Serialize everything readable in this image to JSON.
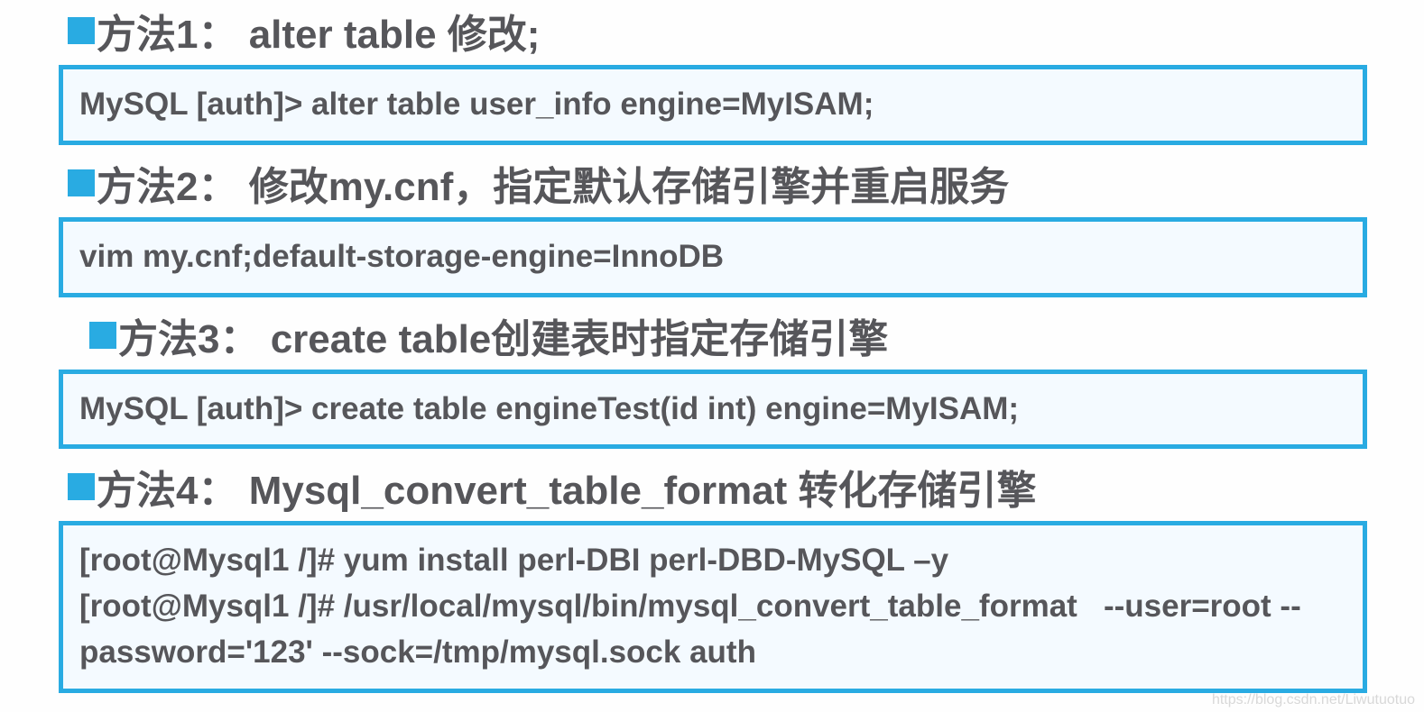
{
  "methods": [
    {
      "heading": "方法1：  alter table 修改;",
      "code": "MySQL [auth]> alter table  user_info engine=MyISAM;",
      "indent": false
    },
    {
      "heading": "方法2：  修改my.cnf，指定默认存储引擎并重启服务",
      "code": "vim  my.cnf;default-storage-engine=InnoDB",
      "indent": false
    },
    {
      "heading": "方法3：  create table创建表时指定存储引擎",
      "code": "MySQL [auth]> create table engineTest(id int) engine=MyISAM;",
      "indent": true
    },
    {
      "heading": "方法4：  Mysql_convert_table_format 转化存储引擎",
      "code": "[root@Mysql1 /]# yum install perl-DBI perl-DBD-MySQL –y\n[root@Mysql1 /]# /usr/local/mysql/bin/mysql_convert_table_format   --user=root --password='123' --sock=/tmp/mysql.sock auth",
      "indent": false
    }
  ],
  "watermark": "https://blog.csdn.net/Liwutuotuo"
}
